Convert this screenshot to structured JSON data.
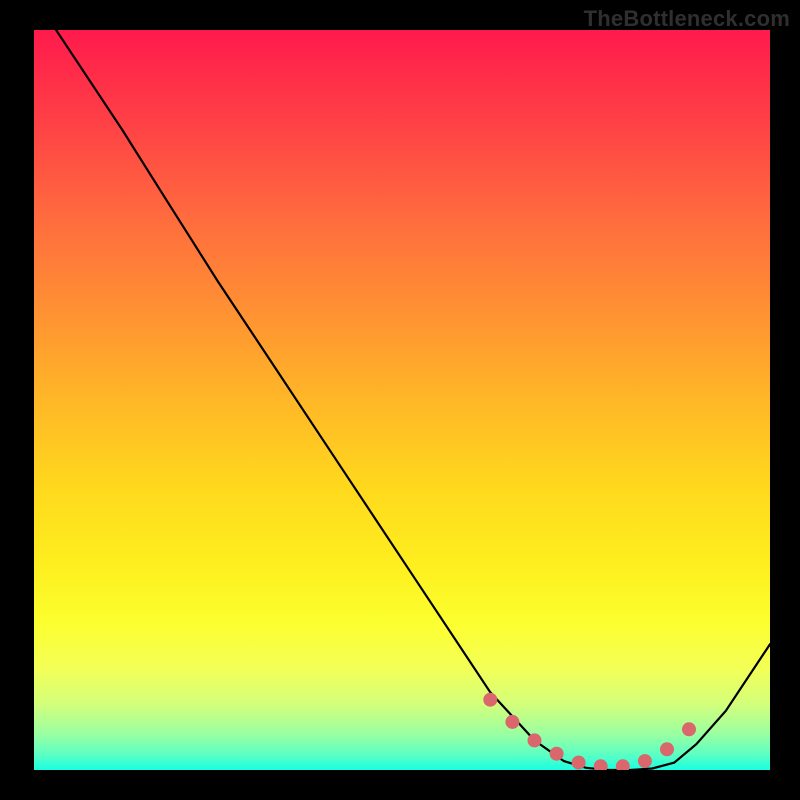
{
  "watermark": {
    "text": "TheBottleneck.com"
  },
  "chart_data": {
    "type": "line",
    "title": "",
    "xlabel": "",
    "ylabel": "",
    "xlim": [
      0,
      100
    ],
    "ylim": [
      0,
      100
    ],
    "series": [
      {
        "name": "bottleneck-curve",
        "x": [
          3,
          7,
          12,
          18,
          25,
          33,
          42,
          52,
          62,
          68,
          72,
          75,
          78,
          81,
          84,
          87,
          90,
          94,
          100
        ],
        "y": [
          100,
          94,
          86.5,
          77,
          66,
          54,
          40.5,
          25.5,
          10.5,
          4,
          1.2,
          0.3,
          0,
          0,
          0.2,
          1,
          3.5,
          8,
          17
        ]
      }
    ],
    "highlight": {
      "name": "recommended-range",
      "x": [
        62,
        65,
        68,
        71,
        74,
        77,
        80,
        83,
        86,
        89
      ],
      "y": [
        9.5,
        6.5,
        4,
        2.2,
        1,
        0.5,
        0.5,
        1.2,
        2.8,
        5.5
      ],
      "color": "#d9676b"
    },
    "background_gradient": {
      "top": "#ff1a4c",
      "bottom": "#19ffe2"
    }
  }
}
